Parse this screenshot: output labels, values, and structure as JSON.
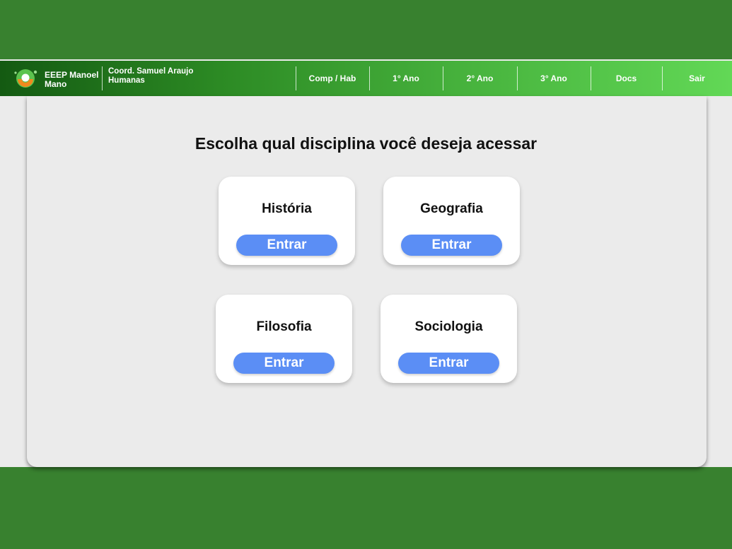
{
  "header": {
    "school_name": "EEEP Manoel Mano",
    "coord_name": "Coord. Samuel Araujo",
    "coord_area": "Humanas",
    "nav": [
      {
        "label": "Comp / Hab"
      },
      {
        "label": "1° Ano"
      },
      {
        "label": "2° Ano"
      },
      {
        "label": "3° Ano"
      },
      {
        "label": "Docs"
      },
      {
        "label": "Sair"
      }
    ]
  },
  "main": {
    "title": "Escolha qual disciplina você deseja acessar",
    "subjects": [
      {
        "name": "História",
        "button": "Entrar"
      },
      {
        "name": "Geografia",
        "button": "Entrar"
      },
      {
        "name": "Filosofia",
        "button": "Entrar"
      },
      {
        "name": "Sociologia",
        "button": "Entrar"
      }
    ]
  },
  "colors": {
    "background": "#38812f",
    "button": "#5b8ef5",
    "panel": "#ebebeb"
  }
}
